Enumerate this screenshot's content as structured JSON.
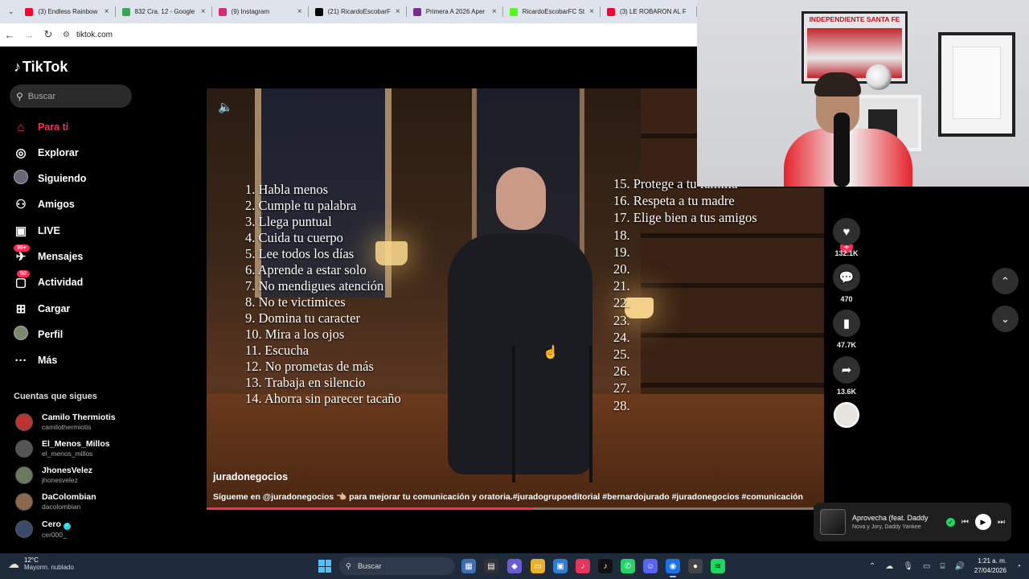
{
  "browser": {
    "tabs": [
      {
        "title": "(3) Endless Rainbow",
        "icon": "youtube-icon",
        "color": "#ff0033"
      },
      {
        "title": "832 Cra. 12 - Google",
        "icon": "google-maps-icon",
        "color": "#34a853"
      },
      {
        "title": "(9) Instagram",
        "icon": "instagram-icon",
        "color": "#d62976"
      },
      {
        "title": "(21) RicardoEscobarF",
        "icon": "x-icon",
        "color": "#000000"
      },
      {
        "title": "Primera A 2026 Aper",
        "icon": "league-icon",
        "color": "#7b2d8e"
      },
      {
        "title": "RicardoEscobarFC St",
        "icon": "kick-icon",
        "color": "#53fc18"
      },
      {
        "title": "(3) LE ROBARON AL F",
        "icon": "youtube-icon",
        "color": "#ff0033"
      }
    ],
    "url": "tiktok.com"
  },
  "tiktok": {
    "logo": "TikTok",
    "search_placeholder": "Buscar",
    "nav": [
      {
        "label": "Para ti",
        "icon": "home-icon",
        "active": true
      },
      {
        "label": "Explorar",
        "icon": "compass-icon"
      },
      {
        "label": "Siguiendo",
        "icon": "following-avatar-icon"
      },
      {
        "label": "Amigos",
        "icon": "friends-icon"
      },
      {
        "label": "LIVE",
        "icon": "live-icon"
      },
      {
        "label": "Mensajes",
        "icon": "messages-icon",
        "badge": "99+"
      },
      {
        "label": "Actividad",
        "icon": "activity-icon",
        "badge": "50"
      },
      {
        "label": "Cargar",
        "icon": "upload-icon"
      },
      {
        "label": "Perfil",
        "icon": "profile-avatar-icon"
      },
      {
        "label": "Más",
        "icon": "more-icon"
      }
    ],
    "following_title": "Cuentas que sigues",
    "following": [
      {
        "name": "Camilo Thermiotis",
        "user": "camilothermiotis"
      },
      {
        "name": "El_Menos_Millos",
        "user": "el_menos_millos"
      },
      {
        "name": "JhonesVelez",
        "user": "jhonesvelez"
      },
      {
        "name": "DaColombian",
        "user": "dacolombian"
      },
      {
        "name": "Cero",
        "user": "cer000_",
        "verified": true
      }
    ],
    "video": {
      "rules_left": [
        "1. Habla menos",
        "2. Cumple tu palabra",
        "3. Llega puntual",
        "4. Cuida tu cuerpo",
        "5. Lee todos los días",
        "6. Aprende a estar solo",
        "7. No mendigues atención",
        "8. No te victimices",
        "9. Domina tu caracter",
        "10. Mira a los ojos",
        "11. Escucha",
        "12. No prometas de más",
        "13. Trabaja en silencio",
        "14. Ahorra sin parecer tacaño"
      ],
      "rules_right": [
        "15. Protege a tu familia",
        "16. Respeta a tu madre",
        "17. Elige bien a tus amigos",
        "18.",
        "19.",
        "20.",
        "21.",
        "22.",
        "23.",
        "24.",
        "25.",
        "26.",
        "27.",
        "28."
      ],
      "author": "juradonegocios",
      "caption": "Sígueme en @juradonegocios 👈🏼 para mejorar tu comunicación y oratoria.#juradogrupoeditorial #bernardojurado #juradonegocios #comunicación",
      "progress": 0.53
    },
    "actions": {
      "likes": "132.1K",
      "comments": "470",
      "saves": "47.7K",
      "shares": "13.6K"
    },
    "accent": "#fe2c55"
  },
  "player": {
    "title": "Aprovecha (feat. Daddy",
    "artist": "Nova y Jory, Daddy Yankee"
  },
  "webcam": {
    "poster_text": "INDEPENDIENTE SANTA FE"
  },
  "taskbar": {
    "temp": "12°C",
    "weather": "Mayorm. nublado",
    "search_placeholder": "Buscar",
    "time": "1:21 a. m.",
    "date": "27/04/2026"
  }
}
